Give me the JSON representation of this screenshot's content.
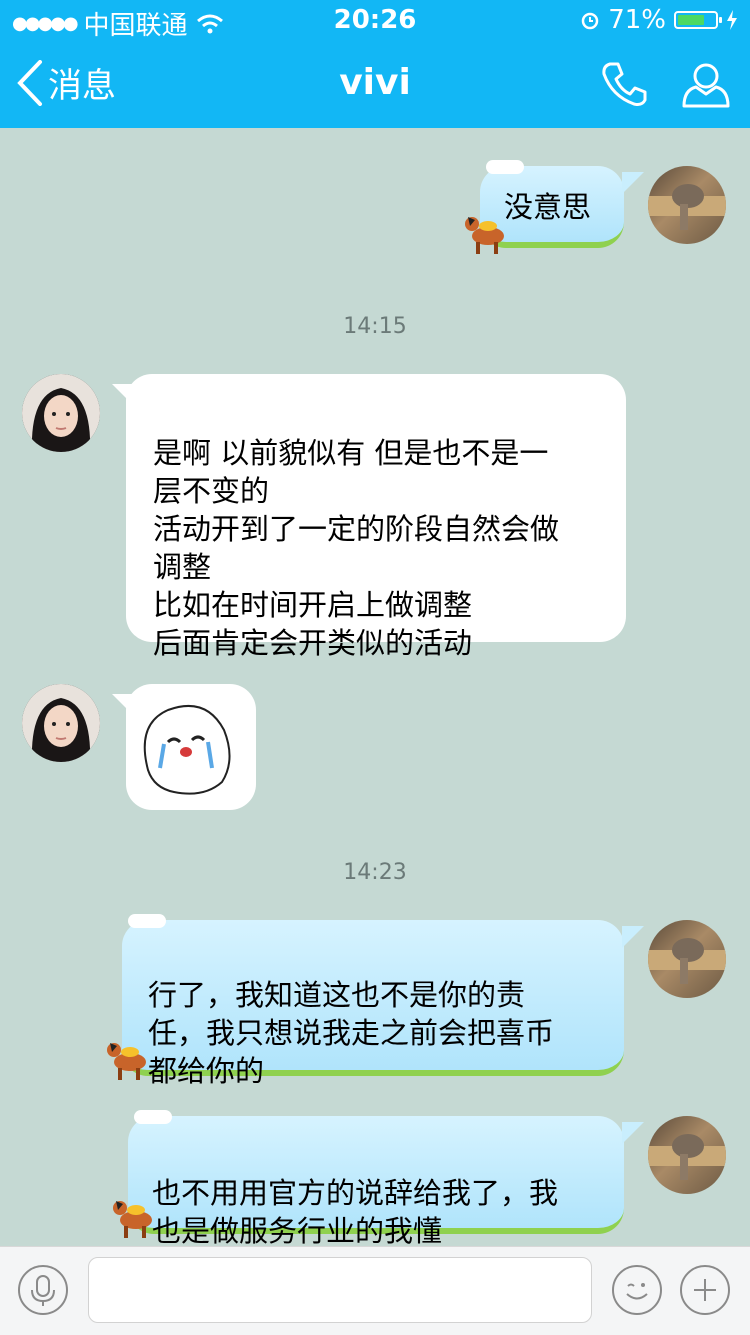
{
  "status": {
    "carrier": "中国联通",
    "time": "20:26",
    "battery": "71%",
    "battery_level": 0.71
  },
  "nav": {
    "back_label": "消息",
    "title": "vivi"
  },
  "timestamps": [
    "14:15",
    "14:23"
  ],
  "messages": [
    {
      "from": "me",
      "text": "没意思"
    },
    {
      "from": "vivi",
      "text": "是啊 以前貌似有 但是也不是一\n层不变的\n活动开到了一定的阶段自然会做\n调整\n比如在时间开启上做调整\n后面肯定会开类似的活动"
    },
    {
      "from": "vivi",
      "type": "sticker",
      "sticker": "crying-face-sticker"
    },
    {
      "from": "me",
      "text": "行了，我知道这也不是你的责\n任，我只想说我走之前会把喜币\n都给你的"
    },
    {
      "from": "me",
      "text": "也不用用官方的说辞给我了，我\n也是做服务行业的我懂"
    }
  ],
  "input": {
    "placeholder": ""
  },
  "colors": {
    "accent": "#12b7f5",
    "background": "#c5d9d3",
    "out_bubble": "#c0eafd",
    "in_bubble": "#ffffff"
  },
  "icons": [
    "chevron-left-icon",
    "phone-icon",
    "profile-icon",
    "microphone-icon",
    "emoji-icon",
    "plus-icon"
  ]
}
